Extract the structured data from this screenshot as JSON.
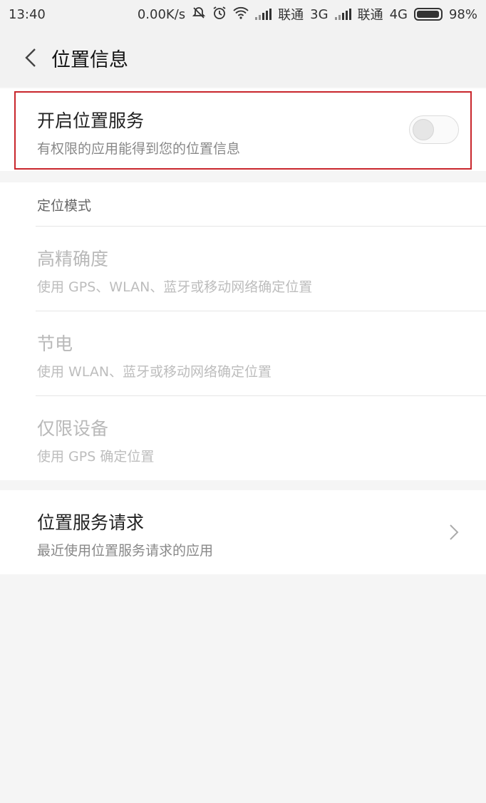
{
  "status_bar": {
    "time": "13:40",
    "speed": "0.00K/s",
    "carrier1": "联通",
    "network1": "3G",
    "carrier2": "联通",
    "network2": "4G",
    "battery_percent": "98%",
    "battery_level": 0.98,
    "icons": [
      "mute-icon",
      "alarm-icon",
      "wifi-icon",
      "signal-icon",
      "battery-icon"
    ]
  },
  "header": {
    "title": "位置信息",
    "back_icon": "chevron-left-icon"
  },
  "location_service": {
    "title": "开启位置服务",
    "subtitle": "有权限的应用能得到您的位置信息",
    "enabled": false,
    "highlight_color": "#c9262c"
  },
  "location_mode": {
    "section_label": "定位模式",
    "options": [
      {
        "title": "高精确度",
        "subtitle": "使用 GPS、WLAN、蓝牙或移动网络确定位置"
      },
      {
        "title": "节电",
        "subtitle": "使用 WLAN、蓝牙或移动网络确定位置"
      },
      {
        "title": "仅限设备",
        "subtitle": "使用 GPS 确定位置"
      }
    ]
  },
  "location_requests": {
    "title": "位置服务请求",
    "subtitle": "最近使用位置服务请求的应用",
    "chevron_icon": "chevron-right-icon"
  }
}
